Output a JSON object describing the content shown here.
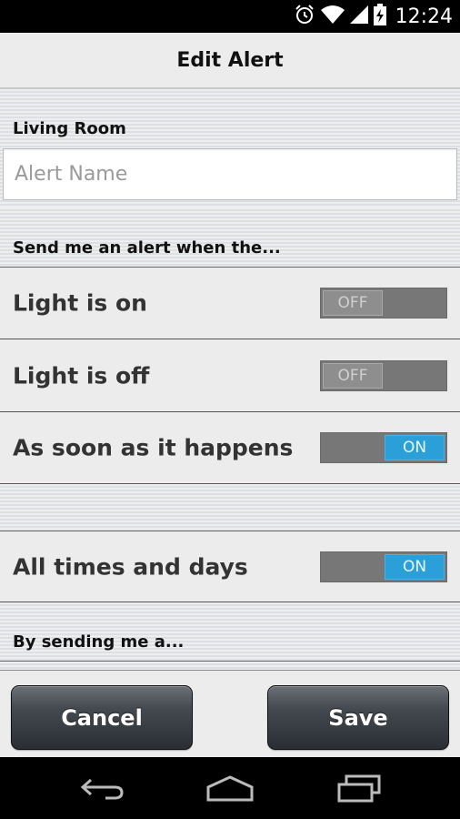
{
  "status_bar": {
    "time": "12:24",
    "icons": [
      "alarm-icon",
      "wifi-icon",
      "signal-icon",
      "battery-charging-icon"
    ]
  },
  "title_bar": {
    "title": "Edit Alert"
  },
  "sections": {
    "location_label": "Living Room",
    "condition_label": "Send me an alert when the...",
    "method_label": "By sending me a..."
  },
  "alert_name": {
    "value": "",
    "placeholder": "Alert Name"
  },
  "toggles": [
    {
      "label": "Light is on",
      "state": "OFF"
    },
    {
      "label": "Light is off",
      "state": "OFF"
    },
    {
      "label": "As soon as it happens",
      "state": "ON"
    },
    {
      "label": "All times and days",
      "state": "ON"
    }
  ],
  "actions": {
    "cancel_label": "Cancel",
    "save_label": "Save"
  },
  "nav_bar": {
    "icons": [
      "back-icon",
      "home-icon",
      "recent-apps-icon"
    ]
  },
  "colors": {
    "switch_on": "#2a9fd8",
    "switch_off": "#8e8e8e",
    "background": "#ececec"
  }
}
